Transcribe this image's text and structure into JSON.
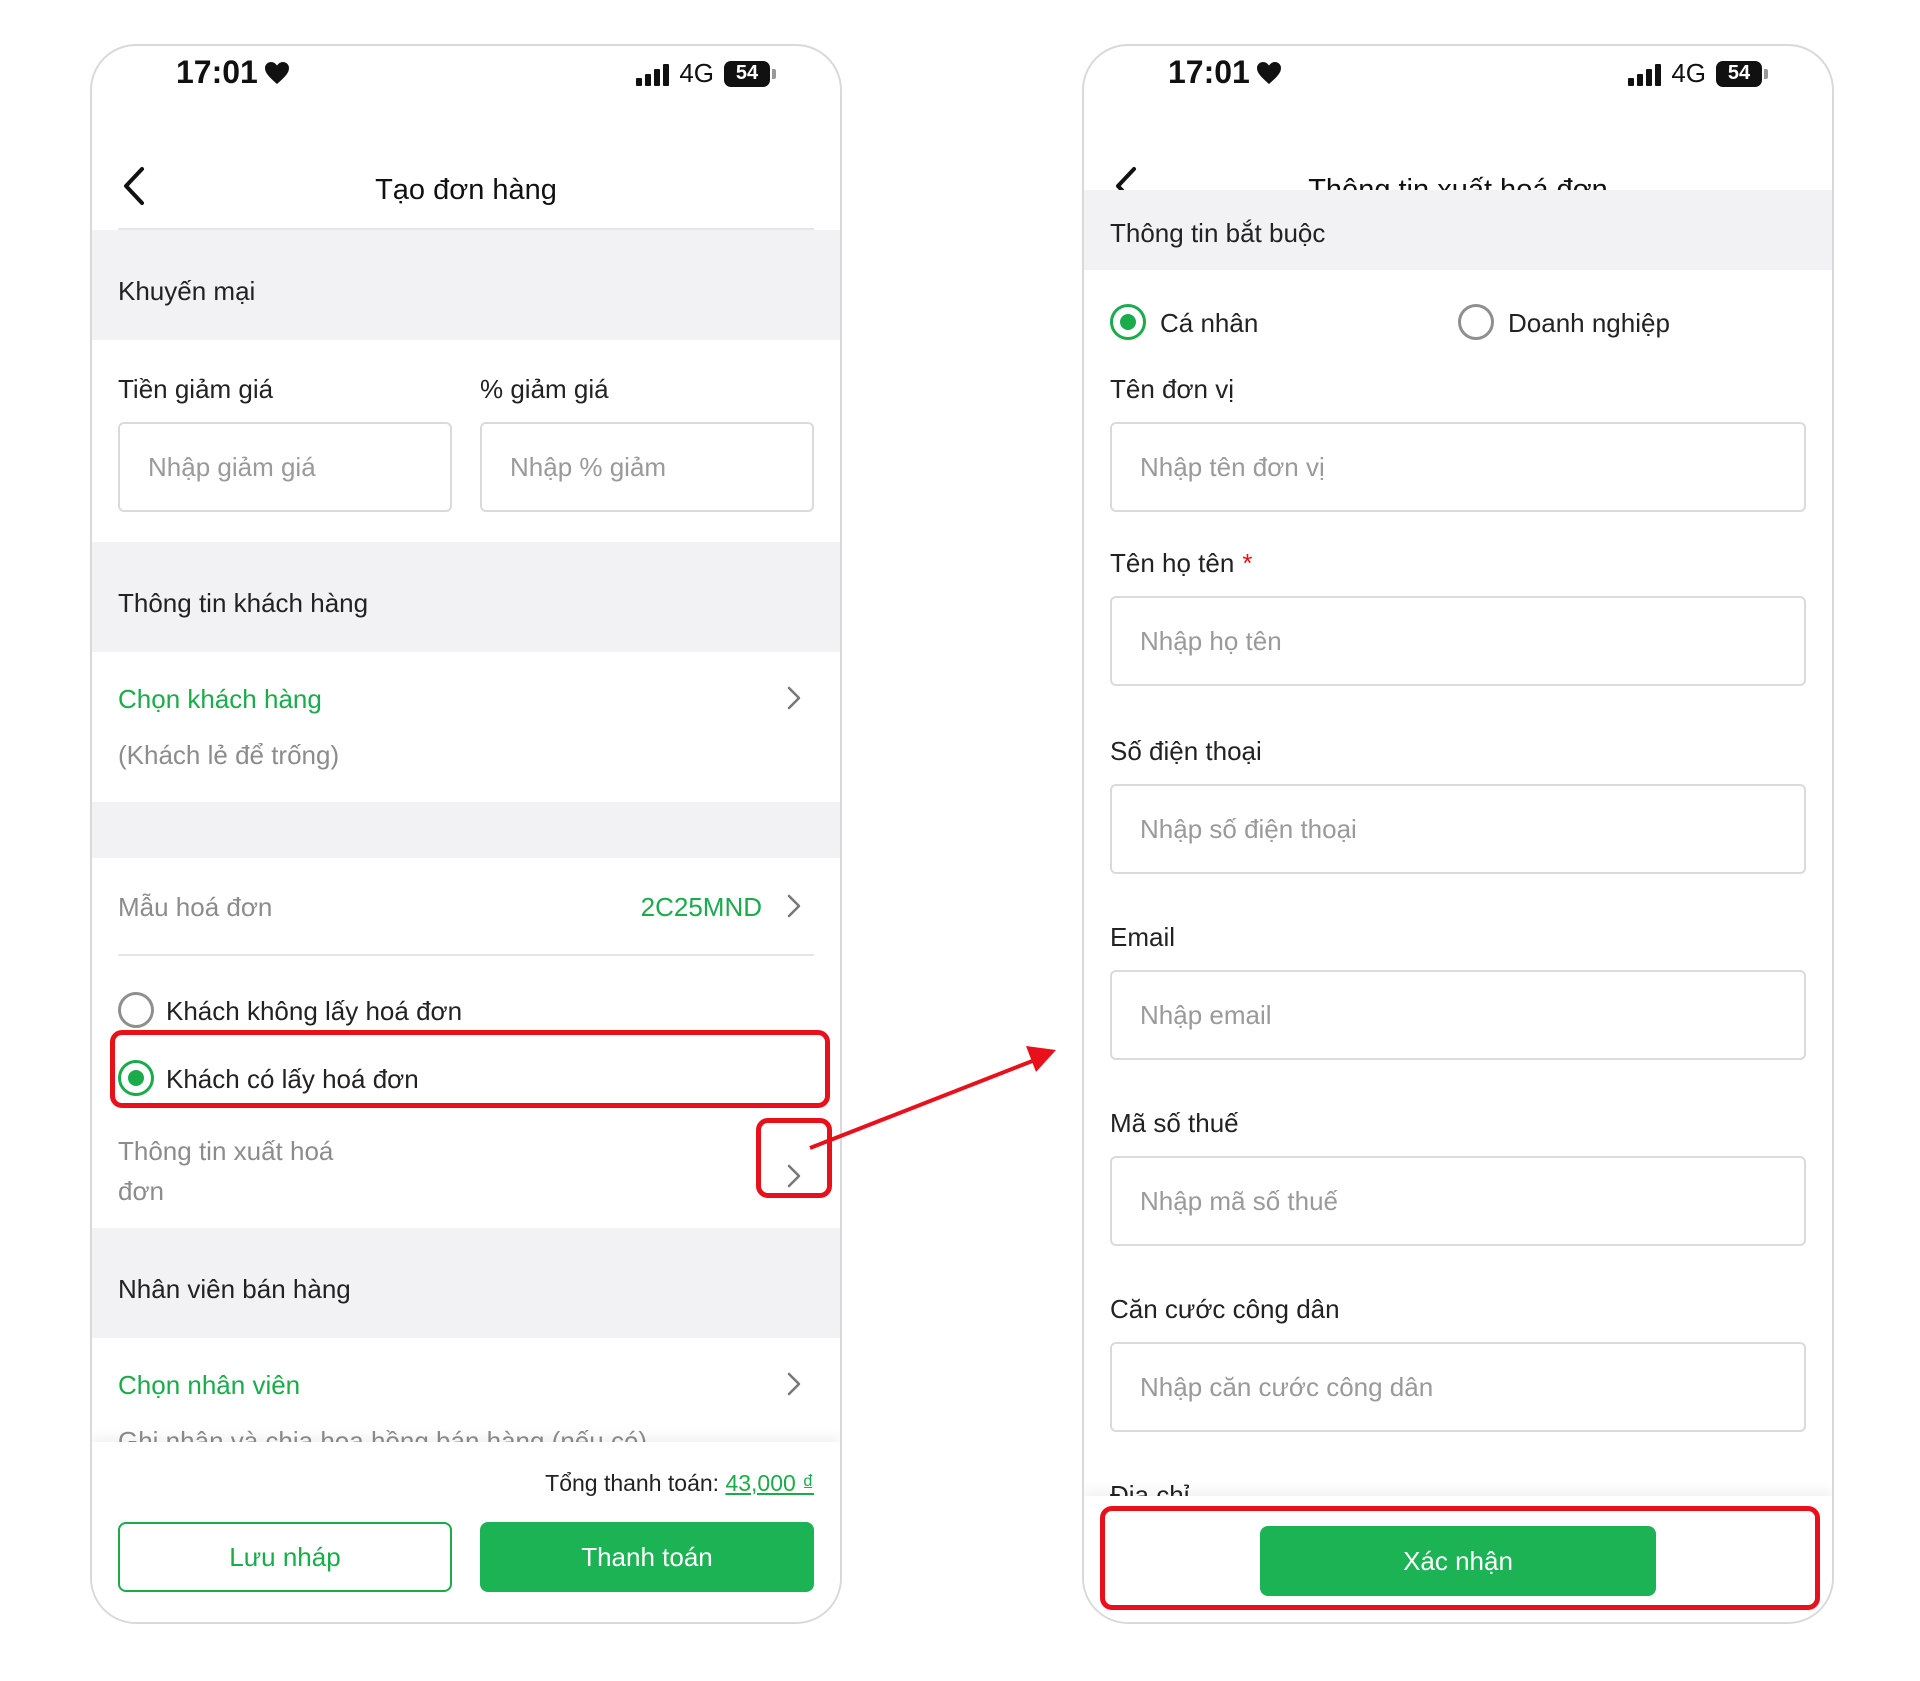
{
  "status_bar": {
    "time": "17:01",
    "network": "4G",
    "battery": "54"
  },
  "left_screen": {
    "title": "Tạo đơn hàng",
    "promo": {
      "section_title": "Khuyến mại",
      "discount_amount_label": "Tiền giảm giá",
      "discount_amount_placeholder": "Nhập giảm giá",
      "discount_percent_label": "% giảm giá",
      "discount_percent_placeholder": "Nhập % giảm"
    },
    "customer": {
      "section_title": "Thông tin khách hàng",
      "choose_label": "Chọn khách hàng",
      "hint": "(Khách lẻ để trống)"
    },
    "invoice": {
      "template_label": "Mẫu hoá đơn",
      "template_value": "2C25MND",
      "option_no_invoice": "Khách không lấy hoá đơn",
      "option_with_invoice": "Khách có lấy hoá đơn",
      "info_label_line1": "Thông tin xuất hoá",
      "info_label_line2": "đơn"
    },
    "staff": {
      "section_title": "Nhân viên bán hàng",
      "choose_label": "Chọn nhân viên",
      "hint": "Ghi nhận và chia hoa hồng bán hàng (nếu có)"
    },
    "footer": {
      "total_label": "Tổng thanh toán:",
      "total_value": "43,000 ₫",
      "save_draft": "Lưu nháp",
      "pay": "Thanh toán"
    }
  },
  "right_screen": {
    "title": "Thông tin xuất hoá đơn",
    "section_title": "Thông tin bắt buộc",
    "type_individual": "Cá nhân",
    "type_business": "Doanh nghiệp",
    "fields": [
      {
        "label": "Tên đơn vị",
        "placeholder": "Nhập tên đơn vị",
        "required": false
      },
      {
        "label": "Tên họ tên",
        "placeholder": "Nhập họ tên",
        "required": true
      },
      {
        "label": "Số điện thoại",
        "placeholder": "Nhập số điện thoại",
        "required": false
      },
      {
        "label": "Email",
        "placeholder": "Nhập email",
        "required": false
      },
      {
        "label": "Mã số thuế",
        "placeholder": "Nhập mã số thuế",
        "required": false
      },
      {
        "label": "Căn cước công dân",
        "placeholder": "Nhập căn cước công dân",
        "required": false
      }
    ],
    "address_label": "Địa chỉ",
    "required_mark": "*",
    "confirm": "Xác nhận"
  },
  "colors": {
    "accent": "#1aab4b",
    "highlight": "#e8101a",
    "section_bg": "#f2f2f4"
  }
}
